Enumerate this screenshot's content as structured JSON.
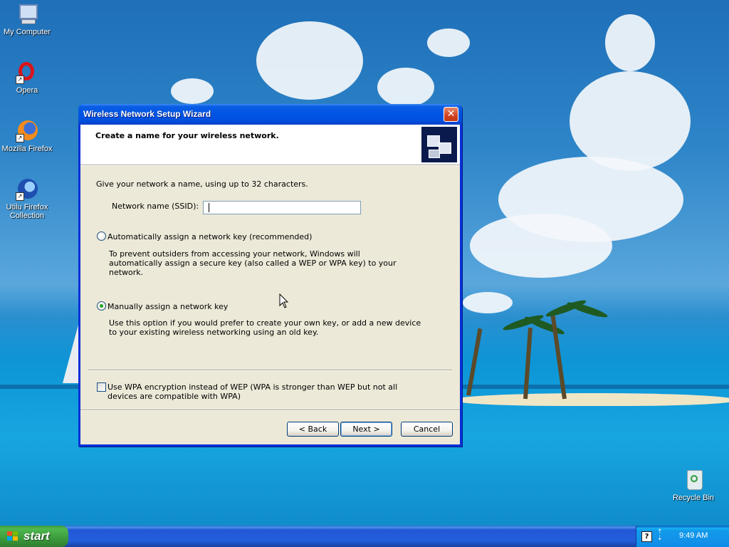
{
  "desktop": {
    "icons": [
      {
        "label": "My Computer"
      },
      {
        "label": "Opera"
      },
      {
        "label": "Mozilla Firefox"
      },
      {
        "label": "Utilu Firefox Collection"
      },
      {
        "label": "Recycle Bin"
      }
    ]
  },
  "wizard": {
    "title": "Wireless Network Setup Wizard",
    "close_glyph": "✕",
    "header_title": "Create a name for your wireless network.",
    "intro": "Give your network a name, using up to 32 characters.",
    "ssid_label": "Network name (SSID):",
    "ssid_value": "",
    "auto_option": {
      "label": "Automatically assign a network key (recommended)",
      "description": "To prevent outsiders from accessing your network, Windows will automatically assign a secure key (also called a WEP or WPA key) to your network.",
      "selected": false
    },
    "manual_option": {
      "label": "Manually assign a network key",
      "description": "Use this option if you would prefer to create your own key, or add a new device to your existing wireless networking using an old key.",
      "selected": true
    },
    "wpa_checkbox": {
      "label": "Use WPA encryption instead of WEP (WPA is stronger than WEP but not all devices are compatible with WPA)",
      "checked": false
    },
    "buttons": {
      "back": "< Back",
      "next": "Next >",
      "cancel": "Cancel"
    }
  },
  "taskbar": {
    "start_label": "start",
    "help_glyph": "?",
    "clock": "9:49 AM"
  },
  "colors": {
    "title_bar": "#0054e3",
    "dialog_face": "#ece9d8",
    "start_green": "#3c9a3c",
    "radio_dot": "#21a121"
  }
}
